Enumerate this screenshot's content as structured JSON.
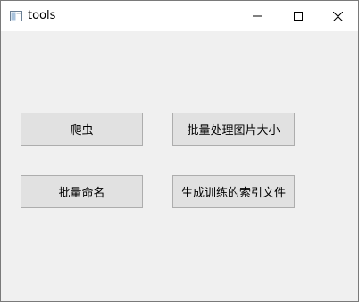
{
  "window": {
    "title": "tools",
    "controls": {
      "minimize_icon": "minimize-icon",
      "maximize_icon": "maximize-icon",
      "close_icon": "close-icon"
    }
  },
  "buttons": [
    {
      "label": "爬虫"
    },
    {
      "label": "批量处理图片大小"
    },
    {
      "label": "批量命名"
    },
    {
      "label": "生成训练的索引文件"
    }
  ],
  "colors": {
    "client_bg": "#f0f0f0",
    "button_bg": "#e1e1e1",
    "button_border": "#adadad",
    "titlebar_bg": "#ffffff"
  }
}
